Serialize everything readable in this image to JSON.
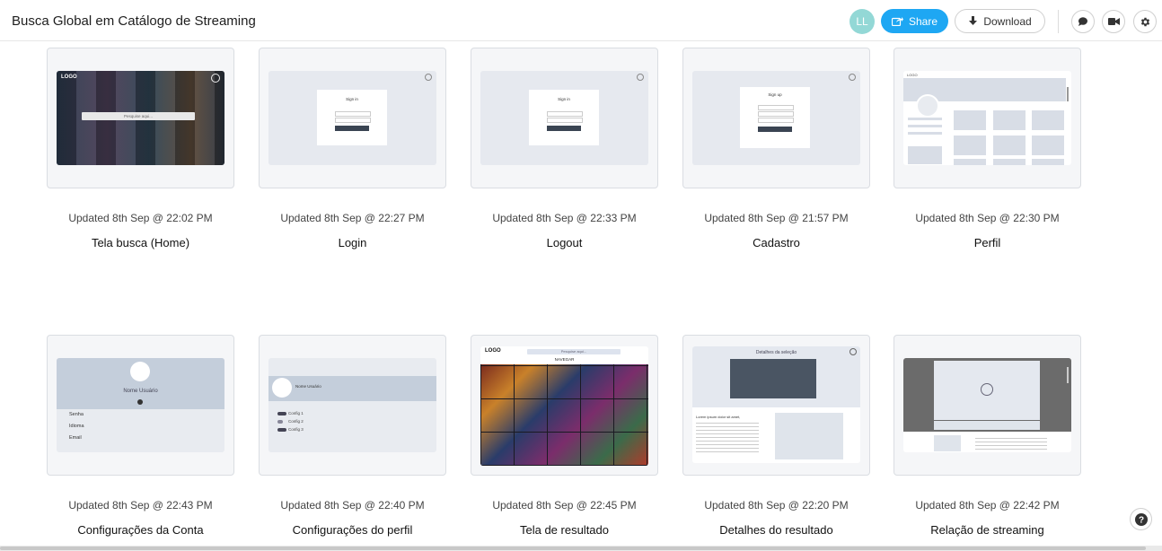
{
  "header": {
    "title": "Busca Global em Catálogo de Streaming",
    "avatar_initials": "LL",
    "share_label": "Share",
    "download_label": "Download",
    "icons": [
      "share-icon",
      "download-icon",
      "comment-icon",
      "video-icon",
      "gear-icon"
    ]
  },
  "colors": {
    "accent": "#1ea7f3",
    "avatar": "#93d8d6"
  },
  "screens": [
    {
      "updated": "Updated 8th Sep @ 22:02 PM",
      "name": "Tela busca (Home)",
      "thumb_text": "Pesquise aqui...",
      "logo": "LOGO"
    },
    {
      "updated": "Updated 8th Sep @ 22:27 PM",
      "name": "Login",
      "thumb_text": "Sign in"
    },
    {
      "updated": "Updated 8th Sep @ 22:33 PM",
      "name": "Logout",
      "thumb_text": "Sign in"
    },
    {
      "updated": "Updated 8th Sep @ 21:57 PM",
      "name": "Cadastro",
      "thumb_text": "Sign up"
    },
    {
      "updated": "Updated 8th Sep @ 22:30 PM",
      "name": "Perfil",
      "logo": "LOGO"
    },
    {
      "updated": "Updated 8th Sep @ 22:43 PM",
      "name": "Configurações da Conta",
      "thumb_text": "Nome Usuário",
      "fields": [
        "Senha",
        "Idioma",
        "Email"
      ]
    },
    {
      "updated": "Updated 8th Sep @ 22:40 PM",
      "name": "Configurações do perfil",
      "thumb_text": "Nome Usuário",
      "fields": [
        "Config 1",
        "Config 2",
        "Config 3"
      ]
    },
    {
      "updated": "Updated 8th Sep @ 22:45 PM",
      "name": "Tela de resultado",
      "logo": "LOGO",
      "thumb_text": "NAVEGAR",
      "search": "Pesquise aqui..."
    },
    {
      "updated": "Updated 8th Sep @ 22:20 PM",
      "name": "Detalhes do resultado",
      "thumb_text": "Detalhes da seleção",
      "subtitle": "Lorem ipsum dolor sit amet,"
    },
    {
      "updated": "Updated 8th Sep @ 22:42 PM",
      "name": "Relação de streaming"
    }
  ]
}
